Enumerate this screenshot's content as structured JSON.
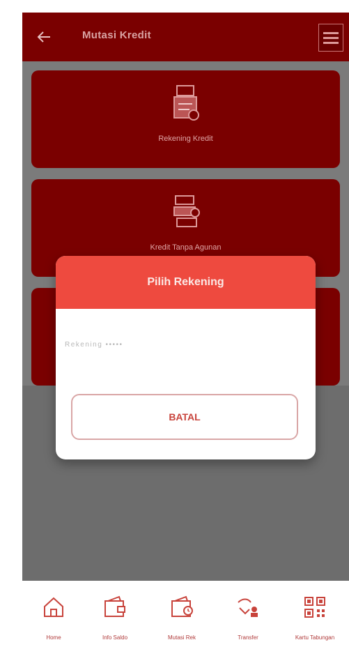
{
  "appbar": {
    "title": "Mutasi Kredit"
  },
  "cards": [
    {
      "label": "Rekening Kredit",
      "icon": "bank-document-icon"
    },
    {
      "label": "Kredit Tanpa Agunan",
      "icon": "money-stack-icon"
    },
    {
      "label": "",
      "icon": ""
    }
  ],
  "dialog": {
    "title": "Pilih Rekening",
    "account_placeholder": "Rekening •••••",
    "cancel_label": "BATAL"
  },
  "bottom_nav": [
    {
      "label": "Home",
      "icon": "home-icon"
    },
    {
      "label": "Info Saldo",
      "icon": "wallet-icon"
    },
    {
      "label": "Mutasi Rek",
      "icon": "wallet-history-icon"
    },
    {
      "label": "Transfer",
      "icon": "transfer-icon"
    },
    {
      "label": "Kartu Tabungan",
      "icon": "qr-code-icon"
    }
  ],
  "colors": {
    "primary": "#7a0000",
    "dialog_header": "#ee4a3f",
    "accent_text": "#c8433b"
  }
}
